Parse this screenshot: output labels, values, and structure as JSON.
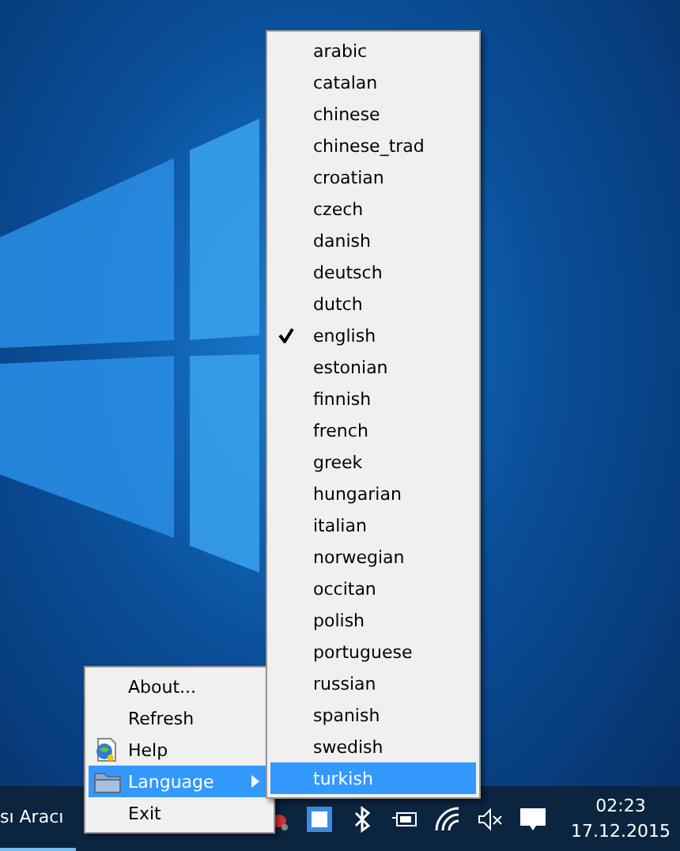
{
  "context_menu": {
    "items": [
      {
        "label": "About...",
        "kind": "plain",
        "selected": false
      },
      {
        "label": "Refresh",
        "kind": "plain",
        "selected": false
      },
      {
        "label": "Help",
        "kind": "help",
        "selected": false
      },
      {
        "label": "Language",
        "kind": "submenu",
        "selected": true
      },
      {
        "label": "Exit",
        "kind": "plain",
        "selected": false
      }
    ]
  },
  "language_menu": {
    "items": [
      {
        "label": "arabic",
        "checked": false,
        "selected": false
      },
      {
        "label": "catalan",
        "checked": false,
        "selected": false
      },
      {
        "label": "chinese",
        "checked": false,
        "selected": false
      },
      {
        "label": "chinese_trad",
        "checked": false,
        "selected": false
      },
      {
        "label": "croatian",
        "checked": false,
        "selected": false
      },
      {
        "label": "czech",
        "checked": false,
        "selected": false
      },
      {
        "label": "danish",
        "checked": false,
        "selected": false
      },
      {
        "label": "deutsch",
        "checked": false,
        "selected": false
      },
      {
        "label": "dutch",
        "checked": false,
        "selected": false
      },
      {
        "label": "english",
        "checked": true,
        "selected": false
      },
      {
        "label": "estonian",
        "checked": false,
        "selected": false
      },
      {
        "label": "finnish",
        "checked": false,
        "selected": false
      },
      {
        "label": "french",
        "checked": false,
        "selected": false
      },
      {
        "label": "greek",
        "checked": false,
        "selected": false
      },
      {
        "label": "hungarian",
        "checked": false,
        "selected": false
      },
      {
        "label": "italian",
        "checked": false,
        "selected": false
      },
      {
        "label": "norwegian",
        "checked": false,
        "selected": false
      },
      {
        "label": "occitan",
        "checked": false,
        "selected": false
      },
      {
        "label": "polish",
        "checked": false,
        "selected": false
      },
      {
        "label": "portuguese",
        "checked": false,
        "selected": false
      },
      {
        "label": "russian",
        "checked": false,
        "selected": false
      },
      {
        "label": "spanish",
        "checked": false,
        "selected": false
      },
      {
        "label": "swedish",
        "checked": false,
        "selected": false
      },
      {
        "label": "turkish",
        "checked": false,
        "selected": true
      }
    ]
  },
  "taskbar": {
    "app_label": "sı Aracı",
    "clock": {
      "time": "02:23",
      "date": "17.12.2015"
    }
  }
}
